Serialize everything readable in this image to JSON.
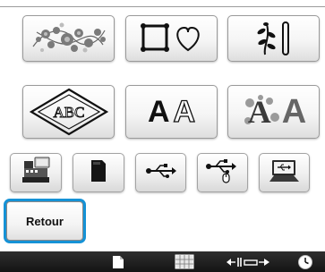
{
  "screen": {
    "category_buttons": [
      {
        "name": "floral-embroidery-category",
        "icon": "floral-motif-icon"
      },
      {
        "name": "frame-shapes-category",
        "icon": "square-heart-frame-icon"
      },
      {
        "name": "utility-borders-category",
        "icon": "vine-border-icon"
      },
      {
        "name": "monogram-category",
        "icon": "monogram-diamond-icon",
        "letters": "ABC"
      },
      {
        "name": "character-fonts-category",
        "icon": "font-letters-icon",
        "letters": [
          "A",
          "A"
        ]
      },
      {
        "name": "decorative-alphabet-category",
        "icon": "decorative-letter-icon",
        "letters": [
          "A",
          "A"
        ]
      }
    ],
    "tool_buttons": [
      {
        "name": "machine-memory-button",
        "icon": "embroidery-machine-icon"
      },
      {
        "name": "card-button",
        "icon": "sd-card-icon"
      },
      {
        "name": "usb-button",
        "icon": "usb-icon"
      },
      {
        "name": "usb-mouse-button",
        "icon": "usb-mouse-icon"
      },
      {
        "name": "computer-button",
        "icon": "computer-icon"
      }
    ],
    "back_button": {
      "label": "Retour",
      "highlight_color": "#1592d6"
    },
    "status_bar": {
      "icons": [
        "document-icon",
        "pattern-grid-icon",
        "presser-foot-width-icon",
        "clock-icon"
      ]
    }
  }
}
